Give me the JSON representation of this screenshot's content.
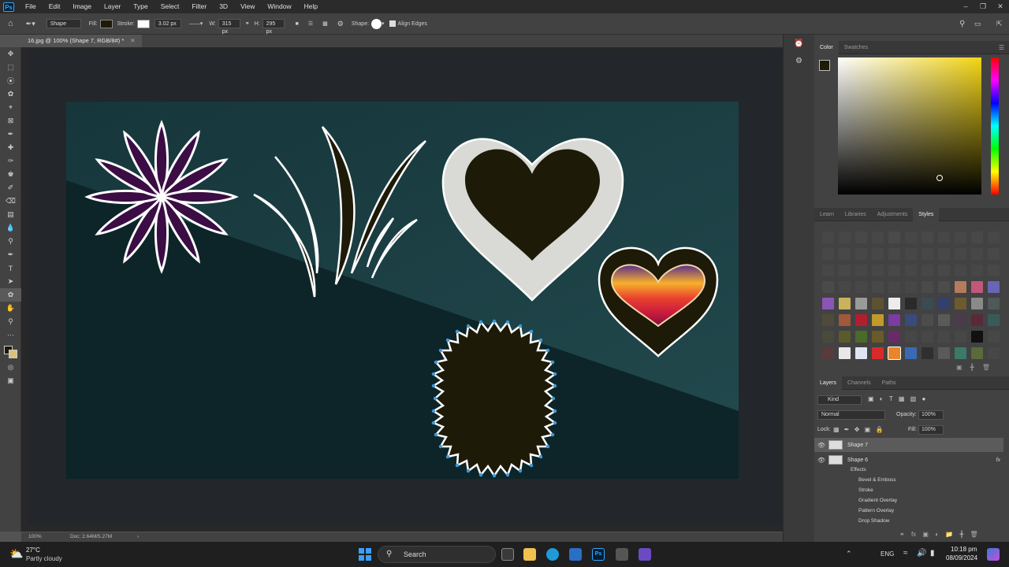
{
  "menubar": {
    "logo": "Ps",
    "items": [
      "File",
      "Edit",
      "Image",
      "Layer",
      "Type",
      "Select",
      "Filter",
      "3D",
      "View",
      "Window",
      "Help"
    ]
  },
  "options": {
    "mode": "Shape",
    "fill_label": "Fill:",
    "stroke_label": "Stroke:",
    "stroke_width": "3.02 px",
    "w_label": "W:",
    "w_value": "315 px",
    "h_label": "H:",
    "h_value": "295 px",
    "shape_label": "Shape:",
    "align_edges": "Align Edges",
    "fill_color": "#1e1a08"
  },
  "document": {
    "tab_title": "16.jpg @ 100% (Shape 7, RGB/8#) *",
    "zoom": "100%",
    "doc_size": "Doc: 2.64M/5.27M"
  },
  "panels": {
    "color_tabs": [
      "Color",
      "Swatches"
    ],
    "mid_tabs": [
      "Learn",
      "Libraries",
      "Adjustments",
      "Styles"
    ],
    "layer_tabs": [
      "Layers",
      "Channels",
      "Paths"
    ],
    "kind": "Kind",
    "blend_mode": "Normal",
    "opacity_label": "Opacity:",
    "opacity": "100%",
    "lock_label": "Lock:",
    "fill_label": "Fill:",
    "fill": "100%",
    "layers": [
      "Shape 7",
      "Shape 6"
    ],
    "effects_label": "Effects",
    "effects": [
      "Bevel & Emboss",
      "Stroke",
      "Gradient Overlay",
      "Pattern Overlay",
      "Drop Shadow"
    ],
    "fx": "fx"
  },
  "taskbar": {
    "weather_temp": "27°C",
    "weather_desc": "Partly cloudy",
    "search": "Search",
    "lang": "ENG",
    "time": "10:18 pm",
    "date": "08/09/2024"
  }
}
